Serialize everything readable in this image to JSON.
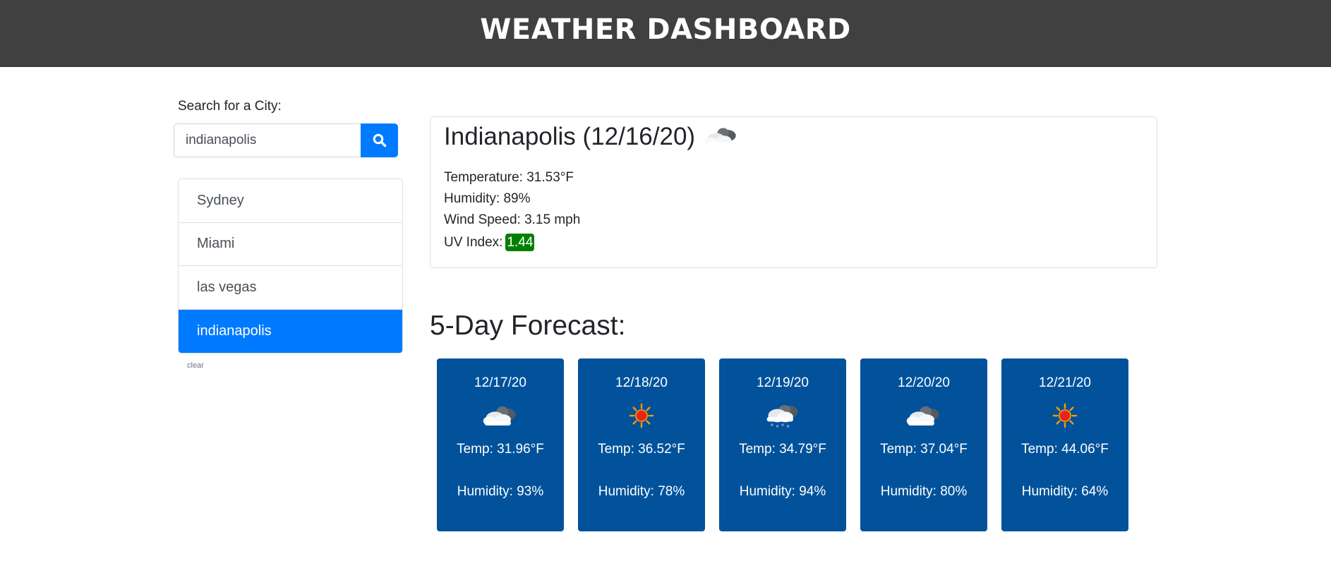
{
  "header": {
    "title": "WEATHER DASHBOARD"
  },
  "search": {
    "label": "Search for a City:",
    "value": "indianapolis",
    "button_icon": "search-icon"
  },
  "history": {
    "items": [
      {
        "label": "Sydney",
        "active": false
      },
      {
        "label": "Miami",
        "active": false
      },
      {
        "label": "las vegas",
        "active": false
      },
      {
        "label": "indianapolis",
        "active": true
      }
    ],
    "clear_label": "clear"
  },
  "current": {
    "title": "Indianapolis (12/16/20)",
    "icon": "cloudy-icon",
    "temperature": "Temperature: 31.53°F",
    "humidity": "Humidity: 89%",
    "wind": "Wind Speed: 3.15 mph",
    "uv_label": "UV Index:",
    "uv_value": "1.44",
    "uv_color": "#008000"
  },
  "forecast": {
    "title": "5-Day Forecast:",
    "days": [
      {
        "date": "12/17/20",
        "icon": "cloudy-icon",
        "temp": "Temp: 31.96°F",
        "humidity": "Humidity: 93%"
      },
      {
        "date": "12/18/20",
        "icon": "sun-icon",
        "temp": "Temp: 36.52°F",
        "humidity": "Humidity: 78%"
      },
      {
        "date": "12/19/20",
        "icon": "snow-icon",
        "temp": "Temp: 34.79°F",
        "humidity": "Humidity: 94%"
      },
      {
        "date": "12/20/20",
        "icon": "cloudy-icon",
        "temp": "Temp: 37.04°F",
        "humidity": "Humidity: 80%"
      },
      {
        "date": "12/21/20",
        "icon": "sun-icon",
        "temp": "Temp: 44.06°F",
        "humidity": "Humidity: 64%"
      }
    ]
  },
  "colors": {
    "header_bg": "#404040",
    "accent": "#007bff",
    "card_bg": "#01529b"
  }
}
